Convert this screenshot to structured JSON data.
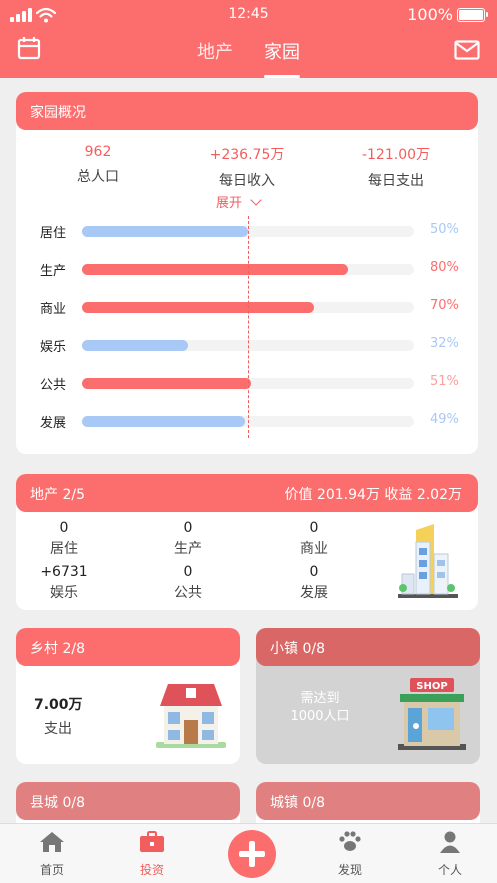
{
  "status": {
    "time": "12:45",
    "battery": "100%"
  },
  "header": {
    "tabs": [
      {
        "label": "地产"
      },
      {
        "label": "家园"
      }
    ],
    "active_tab": "家园"
  },
  "overview": {
    "title": "家园概况",
    "stats": [
      {
        "value": "962",
        "label": "总人口"
      },
      {
        "value": "+236.75万",
        "label": "每日收入"
      },
      {
        "value": "-121.00万",
        "label": "每日支出"
      }
    ],
    "expand_label": "展开",
    "bars": [
      {
        "label": "居住",
        "pct_text": "50%",
        "value": 0.5,
        "color": "#a8c8f5",
        "text_color": "#a8c8f5"
      },
      {
        "label": "生产",
        "pct_text": "80%",
        "value": 0.8,
        "color": "#fb6e6d",
        "text_color": "#fb6e6d"
      },
      {
        "label": "商业",
        "pct_text": "70%",
        "value": 0.7,
        "color": "#fb6e6d",
        "text_color": "#fb6e6d"
      },
      {
        "label": "娱乐",
        "pct_text": "32%",
        "value": 0.32,
        "color": "#a8c8f5",
        "text_color": "#a8c8f5"
      },
      {
        "label": "公共",
        "pct_text": "51%",
        "value": 0.51,
        "color": "#fb6e6d",
        "text_color": "#fba0a0"
      },
      {
        "label": "发展",
        "pct_text": "49%",
        "value": 0.49,
        "color": "#a8c8f5",
        "text_color": "#a8c8f5"
      }
    ]
  },
  "estate": {
    "title": "地产 2/5",
    "value_text": "价值 201.94万 收益 2.02万",
    "items": [
      {
        "value": "0",
        "label": "居住"
      },
      {
        "value": "0",
        "label": "生产"
      },
      {
        "value": "0",
        "label": "商业"
      },
      {
        "value": "+6731",
        "label": "娱乐"
      },
      {
        "value": "0",
        "label": "公共"
      },
      {
        "value": "0",
        "label": "发展"
      }
    ]
  },
  "village": {
    "title": "乡村 2/8",
    "amount": "7.00万",
    "amount_label": "支出"
  },
  "town": {
    "title": "小镇 0/8",
    "requirement": "需达到\n1000人口",
    "shop_sign": "SHOP"
  },
  "county": {
    "title": "县城 0/8"
  },
  "city": {
    "title": "城镇 0/8"
  },
  "nav": [
    {
      "label": "首页",
      "icon": "home-icon"
    },
    {
      "label": "投资",
      "icon": "briefcase-icon"
    },
    {
      "label": "",
      "icon": "plus-icon"
    },
    {
      "label": "发现",
      "icon": "paw-icon"
    },
    {
      "label": "个人",
      "icon": "person-icon"
    }
  ]
}
